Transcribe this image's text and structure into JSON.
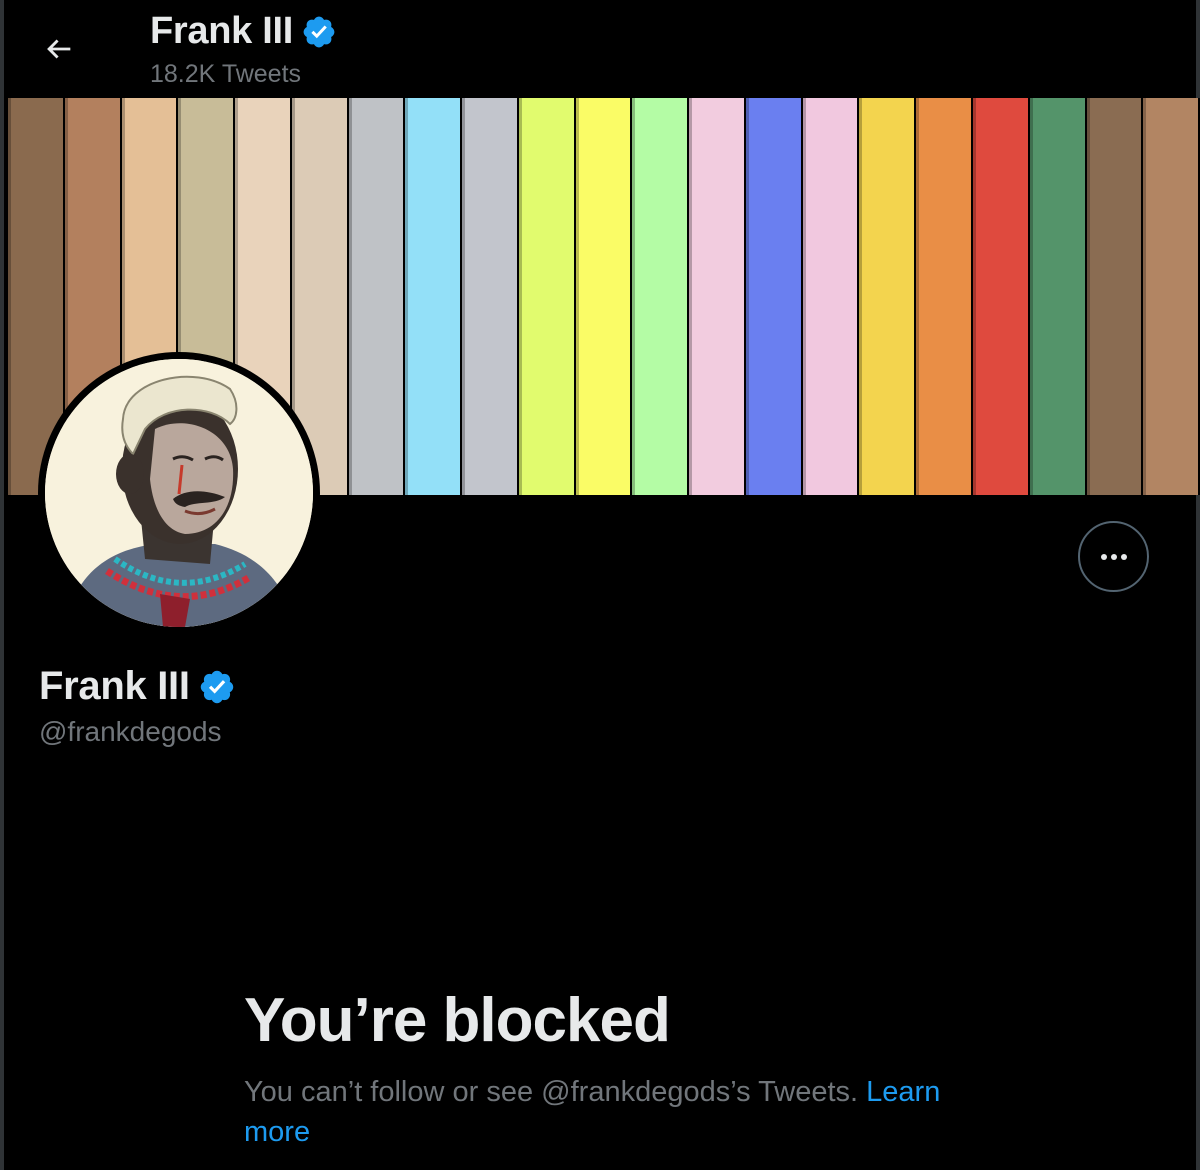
{
  "header": {
    "name": "Frank III",
    "tweets_count": "18.2K Tweets"
  },
  "banner": {
    "stripes": [
      "#8a6a4e",
      "#b3805e",
      "#e4bf96",
      "#c8bc98",
      "#e9d3bb",
      "#dccbb6",
      "#bfc2c6",
      "#93e0f8",
      "#c2c5cc",
      "#e1fb6e",
      "#fafc66",
      "#b4fca5",
      "#f2ccdf",
      "#6a7ff0",
      "#f1c8df",
      "#f3d44e",
      "#e98e46",
      "#df4a3e",
      "#54946a",
      "#8a6c52",
      "#b28563"
    ]
  },
  "profile": {
    "name": "Frank III",
    "handle": "@frankdegods"
  },
  "blocked": {
    "title": "You’re blocked",
    "description": "You can’t follow or see @frankdegods’s Tweets. ",
    "link": "Learn more"
  },
  "colors": {
    "verified": "#1d9bf0",
    "link": "#1d9bf0",
    "secondary_text": "#71767b"
  }
}
